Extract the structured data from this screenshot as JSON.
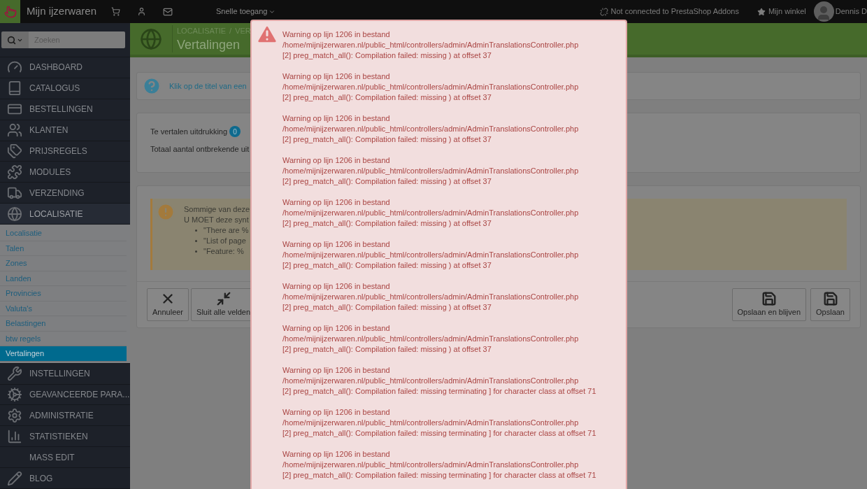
{
  "topbar": {
    "shop_name": "Mijn ijzerwaren",
    "quick_access": "Snelle toegang",
    "addons_status": "Not connected to PrestaShop Addons",
    "my_shop": "Mijn winkel",
    "user": "Dennis D"
  },
  "sidebar": {
    "search": {
      "placeholder": "Zoeken"
    },
    "items": [
      {
        "label": "DASHBOARD",
        "selected": false
      },
      {
        "label": "CATALOGUS",
        "selected": false
      },
      {
        "label": "BESTELLINGEN",
        "selected": false
      },
      {
        "label": "KLANTEN",
        "selected": false
      },
      {
        "label": "PRIJSREGELS",
        "selected": false
      },
      {
        "label": "MODULES",
        "selected": false
      },
      {
        "label": "VERZENDING",
        "selected": false
      },
      {
        "label": "LOCALISATIE",
        "selected": true,
        "children": [
          {
            "label": "Localisatie",
            "selected": false
          },
          {
            "label": "Talen",
            "selected": false
          },
          {
            "label": "Zones",
            "selected": false
          },
          {
            "label": "Landen",
            "selected": false
          },
          {
            "label": "Provincies",
            "selected": false
          },
          {
            "label": "Valuta's",
            "selected": false
          },
          {
            "label": "Belastingen",
            "selected": false
          },
          {
            "label": "btw regels",
            "selected": false
          },
          {
            "label": "Vertalingen",
            "selected": true
          }
        ]
      },
      {
        "label": "INSTELLINGEN",
        "selected": false
      },
      {
        "label": "GEAVANCEERDE PARA...",
        "selected": false
      },
      {
        "label": "ADMINISTRATIE",
        "selected": false
      },
      {
        "label": "STATISTIEKEN",
        "selected": false
      },
      {
        "label": "MASS EDIT",
        "selected": false
      },
      {
        "label": "BLOG",
        "selected": false
      }
    ]
  },
  "header": {
    "breadcrumb": [
      "LOCALISATIE",
      "VER"
    ],
    "separator": "/",
    "title": "Vertalingen"
  },
  "info": "Klik op de titel van een",
  "stats": [
    {
      "label": "Te vertalen uitdrukking",
      "badge": "0"
    },
    {
      "label": "Totaal aantal ontbrekende uit"
    }
  ],
  "notice": {
    "lines": [
      "Sommige van deze",
      "U MOET deze synt"
    ],
    "bullets": [
      "\"There are %",
      "\"List of page",
      "\"Feature: %"
    ]
  },
  "toolbar": {
    "left": [
      {
        "label": "Annuleer",
        "kind": "cancel"
      },
      {
        "label": "Sluit alle velden",
        "kind": "collapse"
      }
    ],
    "right": [
      {
        "label": "Opslaan en blijven",
        "kind": "save"
      },
      {
        "label": "Opslaan",
        "kind": "save"
      }
    ]
  },
  "errors": [
    {
      "heading": "Warning op lijn 1206 in bestand",
      "path": "/home/mijnijzerwaren.nl/public_html/controllers/admin/AdminTranslationsController.php",
      "message": "[2] preg_match_all(): Compilation failed: missing ) at offset 37"
    },
    {
      "heading": "Warning op lijn 1206 in bestand",
      "path": "/home/mijnijzerwaren.nl/public_html/controllers/admin/AdminTranslationsController.php",
      "message": "[2] preg_match_all(): Compilation failed: missing ) at offset 37"
    },
    {
      "heading": "Warning op lijn 1206 in bestand",
      "path": "/home/mijnijzerwaren.nl/public_html/controllers/admin/AdminTranslationsController.php",
      "message": "[2] preg_match_all(): Compilation failed: missing ) at offset 37"
    },
    {
      "heading": "Warning op lijn 1206 in bestand",
      "path": "/home/mijnijzerwaren.nl/public_html/controllers/admin/AdminTranslationsController.php",
      "message": "[2] preg_match_all(): Compilation failed: missing ) at offset 37"
    },
    {
      "heading": "Warning op lijn 1206 in bestand",
      "path": "/home/mijnijzerwaren.nl/public_html/controllers/admin/AdminTranslationsController.php",
      "message": "[2] preg_match_all(): Compilation failed: missing ) at offset 37"
    },
    {
      "heading": "Warning op lijn 1206 in bestand",
      "path": "/home/mijnijzerwaren.nl/public_html/controllers/admin/AdminTranslationsController.php",
      "message": "[2] preg_match_all(): Compilation failed: missing ) at offset 37"
    },
    {
      "heading": "Warning op lijn 1206 in bestand",
      "path": "/home/mijnijzerwaren.nl/public_html/controllers/admin/AdminTranslationsController.php",
      "message": "[2] preg_match_all(): Compilation failed: missing ) at offset 37"
    },
    {
      "heading": "Warning op lijn 1206 in bestand",
      "path": "/home/mijnijzerwaren.nl/public_html/controllers/admin/AdminTranslationsController.php",
      "message": "[2] preg_match_all(): Compilation failed: missing ) at offset 37"
    },
    {
      "heading": "Warning op lijn 1206 in bestand",
      "path": "/home/mijnijzerwaren.nl/public_html/controllers/admin/AdminTranslationsController.php",
      "message": "[2] preg_match_all(): Compilation failed: missing terminating ] for character class at offset 71"
    },
    {
      "heading": "Warning op lijn 1206 in bestand",
      "path": "/home/mijnijzerwaren.nl/public_html/controllers/admin/AdminTranslationsController.php",
      "message": "[2] preg_match_all(): Compilation failed: missing terminating ] for character class at offset 71"
    },
    {
      "heading": "Warning op lijn 1206 in bestand",
      "path": "/home/mijnijzerwaren.nl/public_html/controllers/admin/AdminTranslationsController.php",
      "message": "[2] preg_match_all(): Compilation failed: missing terminating ] for character class at offset 71"
    }
  ]
}
